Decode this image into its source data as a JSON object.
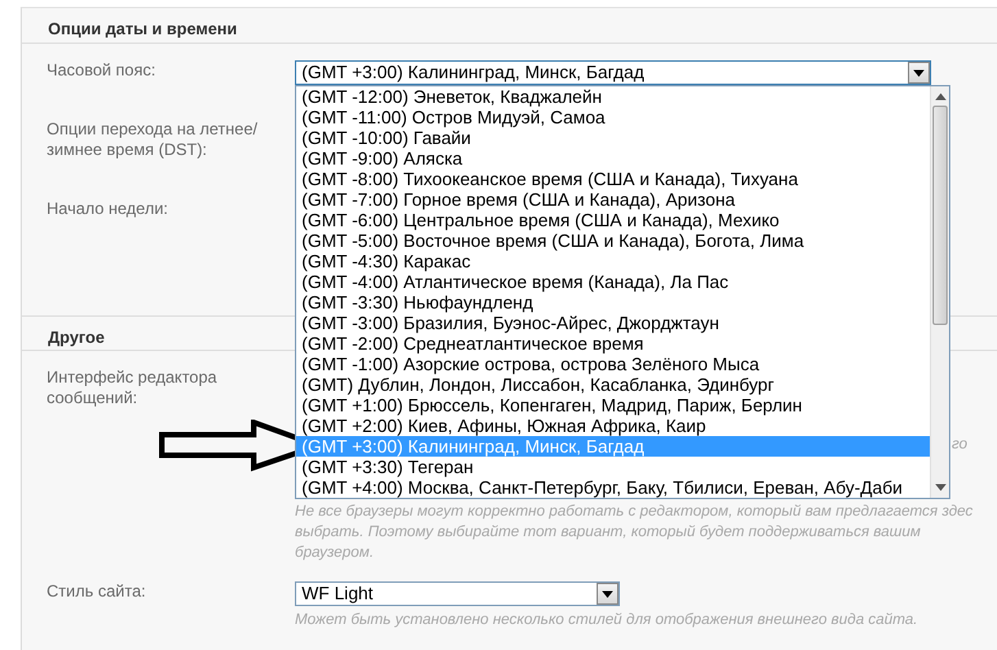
{
  "sections": [
    {
      "title": "Опции даты и времени",
      "fields": [
        {
          "kind": "select",
          "label": "Часовой пояс:",
          "value": "(GMT +3:00) Калининград, Минск, Багдад",
          "expanded": true,
          "options": [
            {
              "label": "(GMT -12:00) Эневеток, Кваджалейн",
              "selected": false
            },
            {
              "label": "(GMT -11:00) Остров Мидуэй, Самоа",
              "selected": false
            },
            {
              "label": "(GMT -10:00) Гавайи",
              "selected": false
            },
            {
              "label": "(GMT -9:00) Аляска",
              "selected": false
            },
            {
              "label": "(GMT -8:00) Тихоокеанское время (США и Канада), Тихуана",
              "selected": false
            },
            {
              "label": "(GMT -7:00) Горное время (США и Канада), Аризона",
              "selected": false
            },
            {
              "label": "(GMT -6:00) Центральное время (США и Канада), Мехико",
              "selected": false
            },
            {
              "label": "(GMT -5:00) Восточное время (США и Канада), Богота, Лима",
              "selected": false
            },
            {
              "label": "(GMT -4:30) Каракас",
              "selected": false
            },
            {
              "label": "(GMT -4:00) Атлантическое время (Канада), Ла Пас",
              "selected": false
            },
            {
              "label": "(GMT -3:30) Ньюфаундленд",
              "selected": false
            },
            {
              "label": "(GMT -3:00) Бразилия, Буэнос-Айрес, Джорджтаун",
              "selected": false
            },
            {
              "label": "(GMT -2:00) Среднеатлантическое время",
              "selected": false
            },
            {
              "label": "(GMT -1:00) Азорские острова, острова Зелёного Мыса",
              "selected": false
            },
            {
              "label": "(GMT) Дублин, Лондон, Лиссабон, Касабланка, Эдинбург",
              "selected": false
            },
            {
              "label": "(GMT +1:00) Брюссель, Копенгаген, Мадрид, Париж, Берлин",
              "selected": false
            },
            {
              "label": "(GMT +2:00) Киев, Афины, Южная Африка, Каир",
              "selected": false
            },
            {
              "label": "(GMT +3:00) Калининград, Минск, Багдад",
              "selected": true
            },
            {
              "label": "(GMT +3:30) Тегеран",
              "selected": false
            },
            {
              "label": "(GMT +4:00) Москва, Санкт-Петербург, Баку, Тбилиси, Ереван, Абу-Даби",
              "selected": false
            }
          ]
        },
        {
          "kind": "blank",
          "label": "Опции перехода на летнее/ зимнее время (DST):"
        },
        {
          "kind": "blank",
          "label": "Начало недели:"
        }
      ]
    },
    {
      "title": "Другое",
      "fields": [
        {
          "kind": "blank",
          "label": "Интерфейс редактора сообщений:",
          "hint_fragment": "го",
          "hint_lines": [
            "Не все браузеры могут корректно работать с редактором, который вам предлагается здес",
            "выбрать. Поэтому выбирайте тот вариант, который будет поддерживаться вашим",
            "браузером."
          ]
        },
        {
          "kind": "select",
          "label": "Стиль сайта:",
          "value": "WF Light",
          "expanded": false,
          "hint_lines": [
            "Может быть установлено несколько стилей для отображения внешнего вида сайта."
          ]
        }
      ]
    }
  ]
}
